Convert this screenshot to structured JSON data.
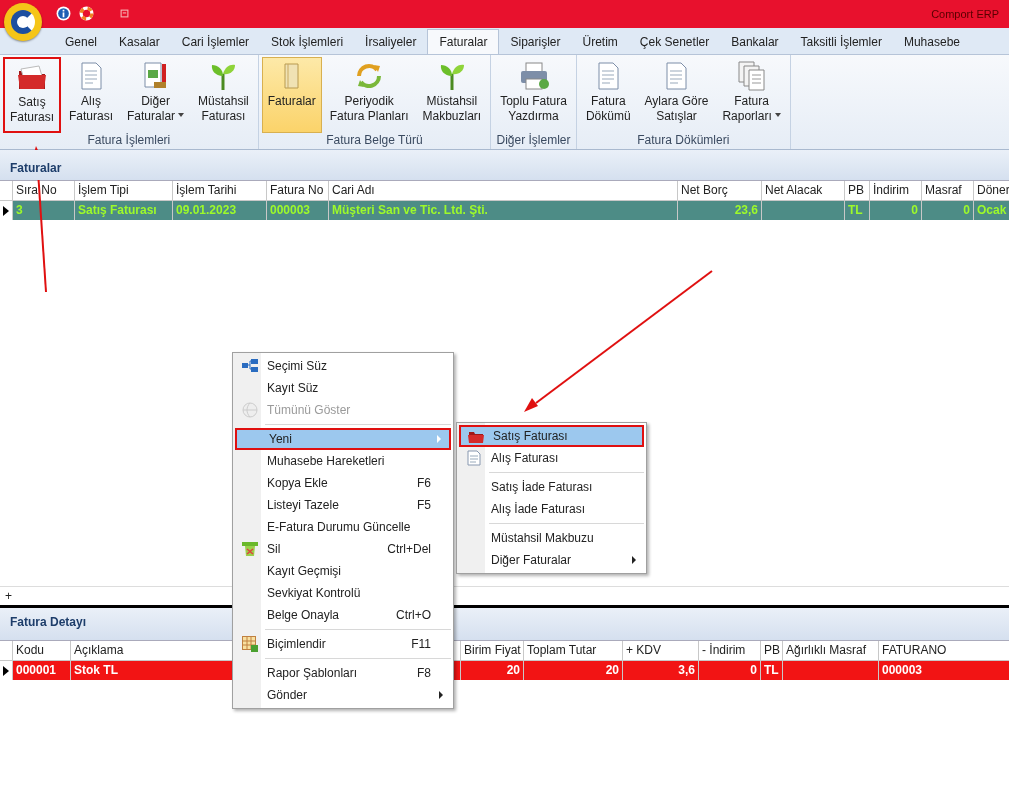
{
  "window": {
    "title": "Comport ERP"
  },
  "tabs": [
    {
      "label": "Genel",
      "selected": false
    },
    {
      "label": "Kasalar",
      "selected": false
    },
    {
      "label": "Cari İşlemler",
      "selected": false
    },
    {
      "label": "Stok İşlemleri",
      "selected": false
    },
    {
      "label": "İrsaliyeler",
      "selected": false
    },
    {
      "label": "Faturalar",
      "selected": true
    },
    {
      "label": "Siparişler",
      "selected": false
    },
    {
      "label": "Üretim",
      "selected": false
    },
    {
      "label": "Çek Senetler",
      "selected": false
    },
    {
      "label": "Bankalar",
      "selected": false
    },
    {
      "label": "Taksitli İşlemler",
      "selected": false
    },
    {
      "label": "Muhasebe",
      "selected": false
    }
  ],
  "ribbon": {
    "groups": [
      {
        "label": "Fatura İşlemleri",
        "buttons": [
          {
            "lines": [
              "Satış",
              "Faturası"
            ],
            "selected": false,
            "dropdown": false,
            "outlined": true
          },
          {
            "lines": [
              "Alış",
              "Faturası"
            ],
            "selected": false,
            "dropdown": false,
            "outlined": false
          },
          {
            "lines": [
              "Diğer",
              "Faturalar"
            ],
            "selected": false,
            "dropdown": true,
            "outlined": false
          },
          {
            "lines": [
              "Müstahsil",
              "Faturası"
            ],
            "selected": false,
            "dropdown": false,
            "outlined": false
          }
        ]
      },
      {
        "label": "Fatura Belge Türü",
        "buttons": [
          {
            "lines": [
              "Faturalar"
            ],
            "selected": true,
            "dropdown": false,
            "outlined": false
          },
          {
            "lines": [
              "Periyodik",
              "Fatura Planları"
            ],
            "selected": false,
            "dropdown": false,
            "outlined": false
          },
          {
            "lines": [
              "Müstahsil",
              "Makbuzları"
            ],
            "selected": false,
            "dropdown": false,
            "outlined": false
          }
        ]
      },
      {
        "label": "Diğer İşlemler",
        "buttons": [
          {
            "lines": [
              "Toplu Fatura",
              "Yazdırma"
            ],
            "selected": false,
            "dropdown": false,
            "outlined": false
          }
        ]
      },
      {
        "label": "Fatura Dökümleri",
        "buttons": [
          {
            "lines": [
              "Fatura",
              "Dökümü"
            ],
            "selected": false,
            "dropdown": false,
            "outlined": false
          },
          {
            "lines": [
              "Aylara Göre",
              "Satışlar"
            ],
            "selected": false,
            "dropdown": false,
            "outlined": false
          },
          {
            "lines": [
              "Fatura",
              "Raporları"
            ],
            "selected": false,
            "dropdown": true,
            "outlined": false
          }
        ]
      }
    ]
  },
  "invoices": {
    "title": "Faturalar",
    "columns": [
      "Sıra No",
      "İşlem Tipi",
      "İşlem Tarihi",
      "Fatura No",
      "Cari Adı",
      "Net Borç",
      "Net Alacak",
      "PB",
      "İndirim",
      "Masraf",
      "Döner"
    ],
    "rows": [
      {
        "selected": true,
        "cells": [
          "3",
          "Satış Faturası",
          "09.01.2023",
          "000003",
          "Müşteri San ve Tic. Ltd. Şti.",
          "23,6",
          "",
          "TL",
          "0",
          "0",
          "Ocak"
        ]
      }
    ],
    "new_row": "+"
  },
  "details": {
    "title": "Fatura Detayı",
    "columns": [
      "Kodu",
      "Açıklama",
      "Birim Fiyat",
      "Toplam Tutar",
      "+ KDV",
      "- İndirim",
      "PB",
      "Ağırlıklı Masraf",
      "FATURANO"
    ],
    "rows": [
      {
        "selected": true,
        "cells": [
          "000001",
          "Stok TL",
          "20",
          "20",
          "3,6",
          "0",
          "TL",
          "",
          "000003"
        ]
      }
    ]
  },
  "context_menu": {
    "items": [
      {
        "kind": "item",
        "label": "Seçimi Süz",
        "disabled": false,
        "selected": false,
        "outlined": false
      },
      {
        "kind": "item",
        "label": "Kayıt Süz",
        "disabled": false,
        "selected": false,
        "outlined": false
      },
      {
        "kind": "item",
        "label": "Tümünü Göster",
        "disabled": true,
        "selected": false,
        "outlined": false
      },
      {
        "kind": "separator"
      },
      {
        "kind": "submenu",
        "label": "Yeni",
        "disabled": false,
        "selected": true,
        "outlined": true
      },
      {
        "kind": "item",
        "label": "Muhasebe Hareketleri",
        "disabled": false,
        "selected": false,
        "outlined": false
      },
      {
        "kind": "item",
        "label": "Kopya Ekle",
        "shortcut": "F6",
        "disabled": false,
        "selected": false,
        "outlined": false
      },
      {
        "kind": "item",
        "label": "Listeyi Tazele",
        "shortcut": "F5",
        "disabled": false,
        "selected": false,
        "outlined": false
      },
      {
        "kind": "item",
        "label": "E-Fatura Durumu Güncelle",
        "disabled": false,
        "selected": false,
        "outlined": false
      },
      {
        "kind": "item",
        "label": "Sil",
        "shortcut": "Ctrl+Del",
        "disabled": false,
        "selected": false,
        "outlined": false
      },
      {
        "kind": "item",
        "label": "Kayıt Geçmişi",
        "disabled": false,
        "selected": false,
        "outlined": false
      },
      {
        "kind": "item",
        "label": "Sevkiyat Kontrolü",
        "disabled": false,
        "selected": false,
        "outlined": false
      },
      {
        "kind": "item",
        "label": "Belge Onayla",
        "shortcut": "Ctrl+O",
        "disabled": false,
        "selected": false,
        "outlined": false
      },
      {
        "kind": "separator"
      },
      {
        "kind": "item",
        "label": "Biçimlendir",
        "shortcut": "F11",
        "disabled": false,
        "selected": false,
        "outlined": false
      },
      {
        "kind": "separator"
      },
      {
        "kind": "item",
        "label": "Rapor Şablonları",
        "shortcut": "F8",
        "disabled": false,
        "selected": false,
        "outlined": false
      },
      {
        "kind": "submenu",
        "label": "Gönder",
        "disabled": false,
        "selected": false,
        "outlined": false
      }
    ]
  },
  "submenu": {
    "items": [
      {
        "kind": "item",
        "label": "Satış Faturası",
        "disabled": false,
        "selected": true,
        "outlined": true
      },
      {
        "kind": "item",
        "label": "Alış Faturası",
        "disabled": false,
        "selected": false,
        "outlined": false
      },
      {
        "kind": "separator"
      },
      {
        "kind": "item",
        "label": "Satış İade Faturası",
        "disabled": false,
        "selected": false,
        "outlined": false
      },
      {
        "kind": "item",
        "label": "Alış İade Faturası",
        "disabled": false,
        "selected": false,
        "outlined": false
      },
      {
        "kind": "separator"
      },
      {
        "kind": "item",
        "label": "Müstahsil Makbuzu",
        "disabled": false,
        "selected": false,
        "outlined": false
      },
      {
        "kind": "submenu",
        "label": "Diğer Faturalar",
        "disabled": false,
        "selected": false,
        "outlined": false
      }
    ]
  }
}
